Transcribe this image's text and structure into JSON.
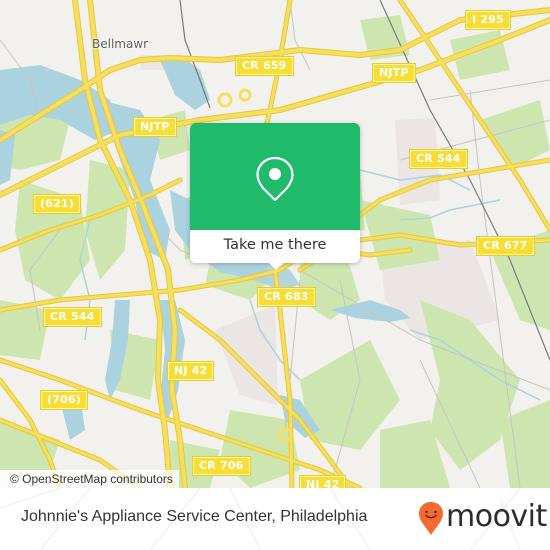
{
  "map": {
    "colors": {
      "background": "#f2f1ee",
      "water": "#aad3df",
      "park": "#cde6b0",
      "road": "#f6de5e",
      "road_casing": "#e5c83a",
      "railway": "#7a7a7a",
      "minor_road": "#c8c4c0",
      "industrial": "#ebe5e3"
    },
    "place_labels": [
      {
        "name": "Bellmawr"
      }
    ],
    "road_shields": [
      {
        "label": "I 295"
      },
      {
        "label": "CR 659"
      },
      {
        "label": "NJTP"
      },
      {
        "label": "NJTP"
      },
      {
        "label": "CR 544"
      },
      {
        "label": "(621)"
      },
      {
        "label": "CR 677"
      },
      {
        "label": "CR 683"
      },
      {
        "label": "CR 544"
      },
      {
        "label": "NJ 42"
      },
      {
        "label": "(706)"
      },
      {
        "label": "CR 706"
      },
      {
        "label": "NJ 42"
      }
    ],
    "attribution": "© OpenStreetMap contributors"
  },
  "popup": {
    "icon": "map-pin-icon",
    "button_label": "Take me there",
    "accent_color": "#1fba6a"
  },
  "footer": {
    "title": "Johnnie's Appliance Service Center, Philadelphia",
    "brand": {
      "name": "moovit",
      "icon": "moovit-pin-smile-icon",
      "color": "#f26a30"
    }
  }
}
